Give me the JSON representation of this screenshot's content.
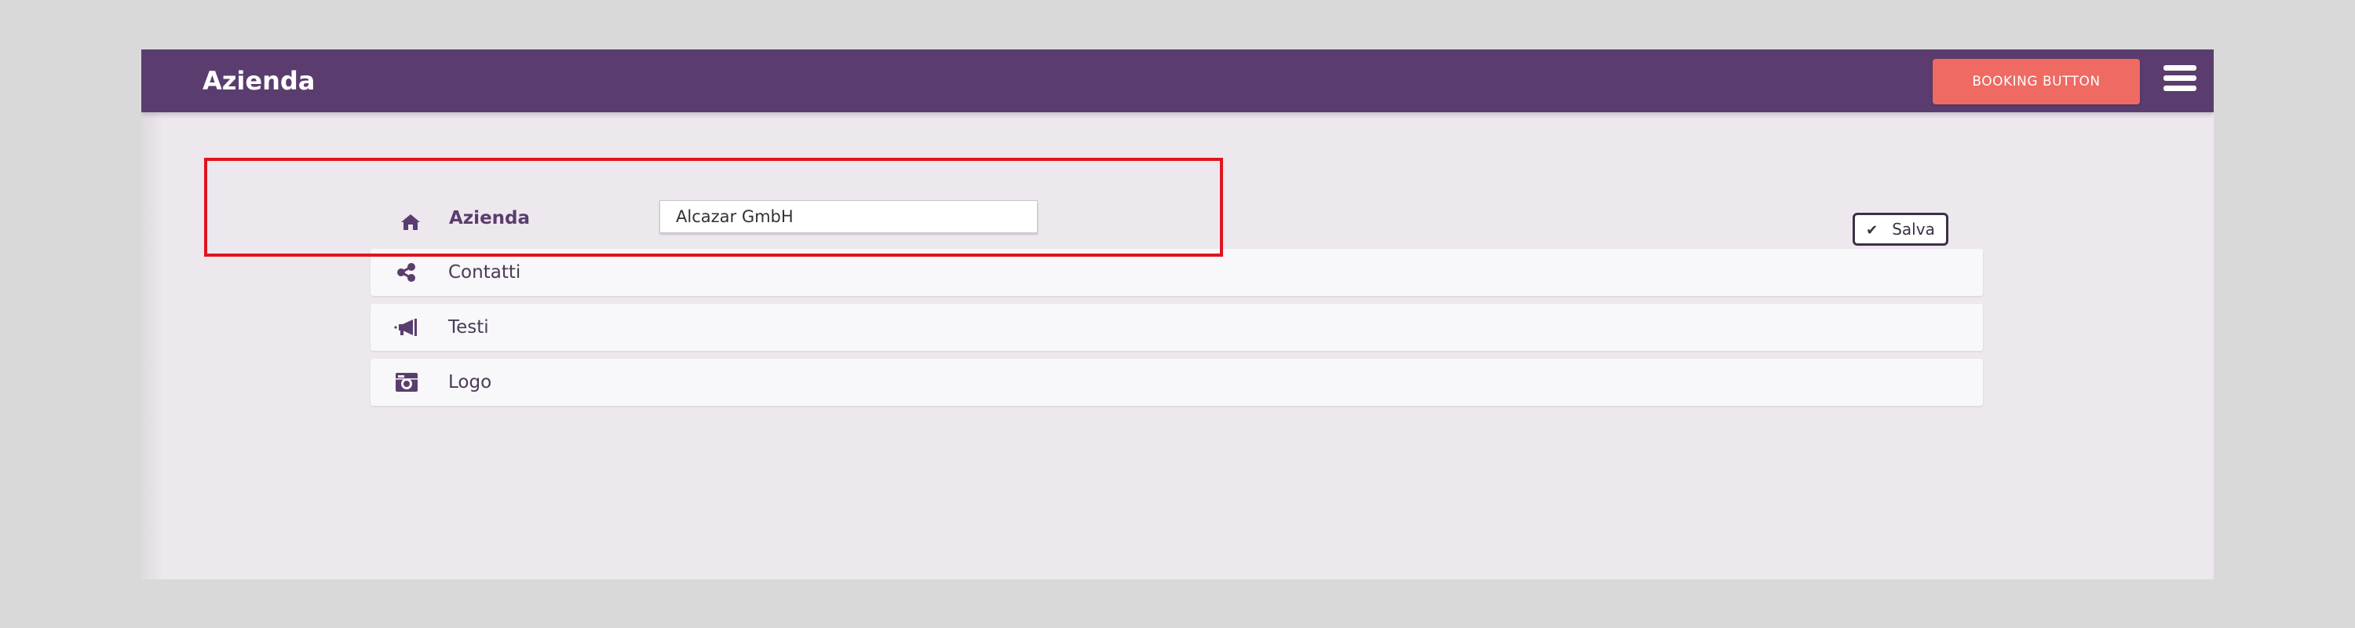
{
  "header": {
    "title": "Azienda",
    "booking_label": "BOOKING BUTTON",
    "menu_icon": "hamburger-menu-icon"
  },
  "section": {
    "icon": "home-icon",
    "label": "Azienda",
    "company_name_value": "Alcazar GmbH",
    "save_label": "Salva",
    "save_icon": "check-icon"
  },
  "accordion": {
    "contacts": {
      "label": "Contatti",
      "icon": "share-icon"
    },
    "texts": {
      "label": "Testi",
      "icon": "megaphone-icon"
    },
    "logo": {
      "label": "Logo",
      "icon": "camera-icon"
    }
  },
  "colors": {
    "primary": "#5a3d6e",
    "accent": "#ef6a62",
    "background": "#ede8ee",
    "highlight": "#e0141c"
  }
}
